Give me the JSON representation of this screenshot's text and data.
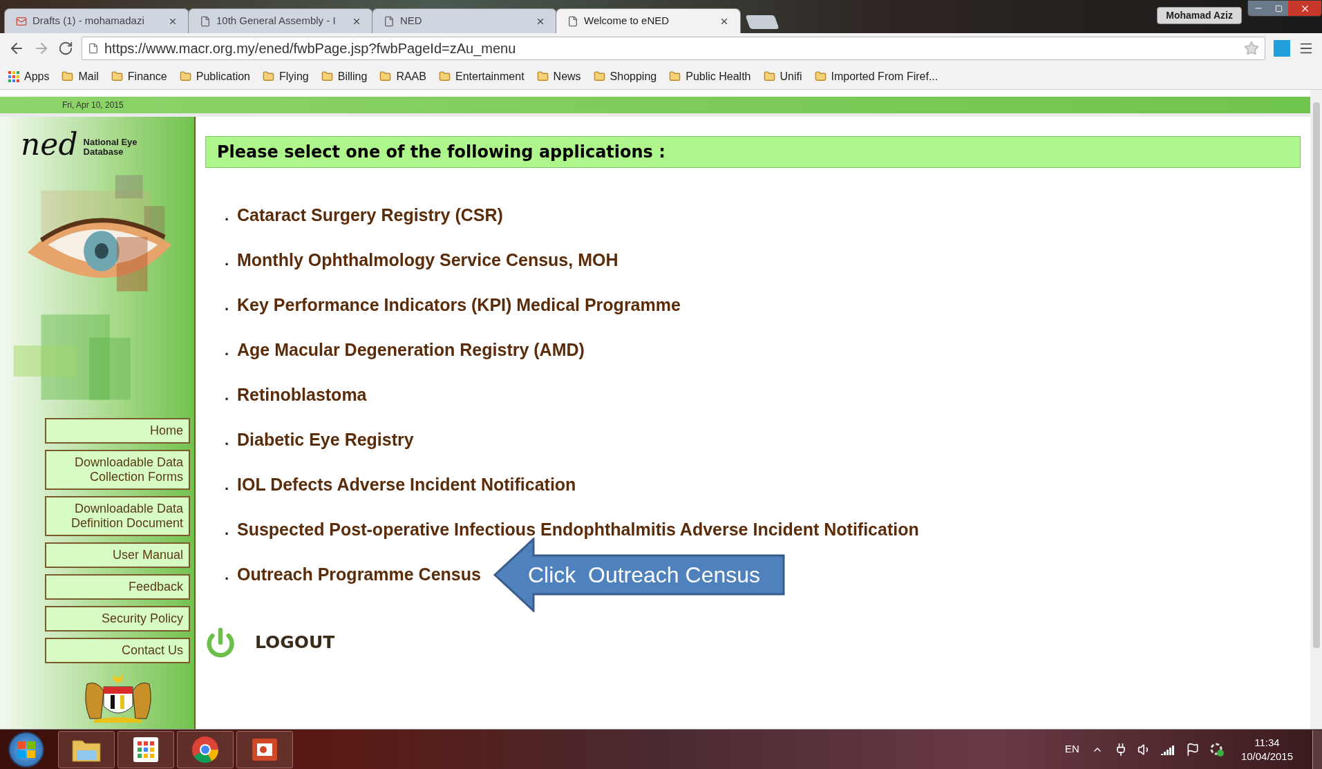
{
  "browser": {
    "tabs": [
      {
        "kind": "mail",
        "title": "Drafts (1) - mohamadazi",
        "selected": false
      },
      {
        "kind": "page",
        "title": "10th General Assembly - I",
        "selected": false
      },
      {
        "kind": "page",
        "title": "NED",
        "selected": false
      },
      {
        "kind": "page",
        "title": "Welcome to eNED",
        "selected": true
      }
    ],
    "profile": "Mohamad Aziz",
    "url": "https://www.macr.org.my/ened/fwbPage.jsp?fwbPageId=zAu_menu",
    "bookmarks": [
      {
        "kind": "apps",
        "label": "Apps"
      },
      {
        "kind": "folder",
        "label": "Mail"
      },
      {
        "kind": "folder",
        "label": "Finance"
      },
      {
        "kind": "folder",
        "label": "Publication"
      },
      {
        "kind": "folder",
        "label": "Flying"
      },
      {
        "kind": "folder",
        "label": "Billing"
      },
      {
        "kind": "folder",
        "label": "RAAB"
      },
      {
        "kind": "folder",
        "label": "Entertainment"
      },
      {
        "kind": "folder",
        "label": "News"
      },
      {
        "kind": "folder",
        "label": "Shopping"
      },
      {
        "kind": "folder",
        "label": "Public Health"
      },
      {
        "kind": "folder",
        "label": "Unifi"
      },
      {
        "kind": "folder",
        "label": "Imported From Firef..."
      }
    ]
  },
  "page": {
    "date": "Fri, Apr 10, 2015",
    "logo": {
      "mark": "ned",
      "tagline_1": "National Eye",
      "tagline_2": "Database"
    },
    "nav": [
      {
        "lines": [
          "Home"
        ]
      },
      {
        "lines": [
          "Downloadable Data",
          "Collection Forms"
        ]
      },
      {
        "lines": [
          "Downloadable Data",
          "Definition Document"
        ]
      },
      {
        "lines": [
          "User Manual"
        ]
      },
      {
        "lines": [
          "Feedback"
        ]
      },
      {
        "lines": [
          "Security Policy"
        ]
      },
      {
        "lines": [
          "Contact Us"
        ]
      }
    ],
    "heading": "Please select one of the following applications :",
    "applications": [
      {
        "bullet": ".",
        "label": "Cataract Surgery Registry (CSR)"
      },
      {
        "bullet": ".",
        "label": "Monthly Ophthalmology Service Census, MOH"
      },
      {
        "bullet": ".",
        "label": "Key Performance Indicators (KPI) Medical Programme"
      },
      {
        "bullet": ".",
        "label": "Age Macular Degeneration Registry (AMD)"
      },
      {
        "bullet": ".",
        "label": "Retinoblastoma"
      },
      {
        "bullet": ".",
        "label": "Diabetic Eye Registry"
      },
      {
        "bullet": ".",
        "label": "IOL Defects Adverse Incident Notification"
      },
      {
        "bullet": ".",
        "label": "Suspected Post-operative Infectious Endophthalmitis Adverse Incident Notification"
      },
      {
        "bullet": ".",
        "label": "Outreach Programme Census",
        "callout": "Click  Outreach Census"
      }
    ],
    "logout": "LOGOUT"
  },
  "taskbar": {
    "apps": [
      {
        "kind": "explorer"
      },
      {
        "kind": "apps"
      },
      {
        "kind": "chrome"
      },
      {
        "kind": "presentation"
      }
    ],
    "language": "EN",
    "time": "11:34",
    "date": "10/04/2015"
  }
}
